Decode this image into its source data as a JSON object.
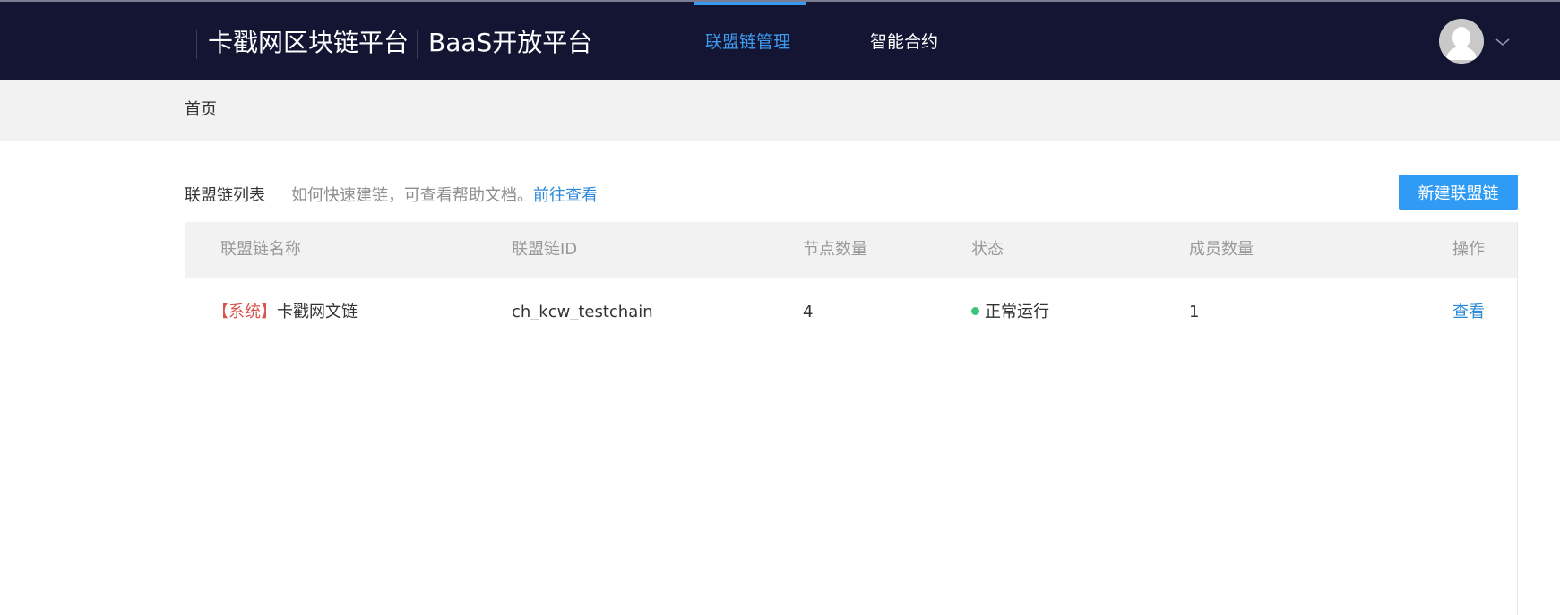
{
  "header": {
    "brand_name": "卡戳网区块链平台",
    "product_name": "BaaS开放平台",
    "nav": [
      {
        "label": "联盟链管理",
        "active": true
      },
      {
        "label": "智能合约",
        "active": false
      }
    ],
    "colors": {
      "bar": "#131533",
      "accent": "#3b99ef"
    }
  },
  "breadcrumb": {
    "home": "首页"
  },
  "list": {
    "title": "联盟链列表",
    "hint_text": "如何快速建链，可查看帮助文档。",
    "hint_link": "前往查看",
    "new_button": "新建联盟链"
  },
  "table": {
    "columns": [
      "联盟链名称",
      "联盟链ID",
      "节点数量",
      "状态",
      "成员数量",
      "操作"
    ],
    "rows": [
      {
        "tag": "【系统】",
        "name": "卡戳网文链",
        "id": "ch_kcw_testchain",
        "nodes": "4",
        "status": "正常运行",
        "members": "1",
        "action": "查看"
      }
    ]
  }
}
